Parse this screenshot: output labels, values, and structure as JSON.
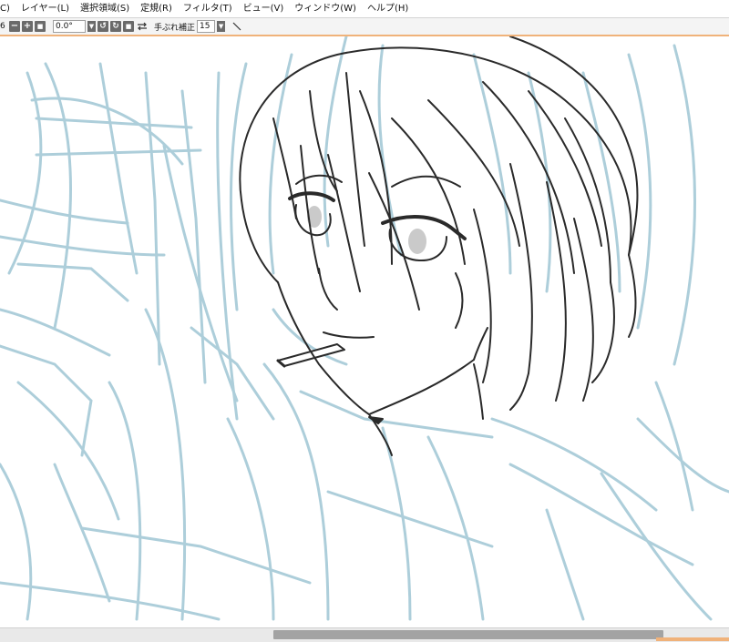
{
  "menu": [
    {
      "id": "c",
      "label": "C)"
    },
    {
      "id": "layer",
      "label": "レイヤー(L)"
    },
    {
      "id": "select",
      "label": "選択領域(S)"
    },
    {
      "id": "ruler",
      "label": "定規(R)"
    },
    {
      "id": "filter",
      "label": "フィルタ(T)"
    },
    {
      "id": "view",
      "label": "ビュー(V)"
    },
    {
      "id": "window",
      "label": "ウィンドウ(W)"
    },
    {
      "id": "help",
      "label": "ヘルプ(H)"
    }
  ],
  "toolbar": {
    "zoom_suffix": "6",
    "rotation": "0.0°",
    "stabilizer_label": "手ぶれ補正",
    "stabilizer_value": "15"
  },
  "icons": {
    "zoom_out": "minus-icon",
    "zoom_in": "plus-icon",
    "zoom_reset": "square-icon",
    "rotate_left": "rotate-left-icon",
    "rotate_right": "rotate-right-icon",
    "rotate_reset": "square-icon",
    "flip": "flip-horizontal-icon",
    "pen": "pen-icon"
  },
  "colors": {
    "accent": "#f0b27a",
    "sketch_blue": "#a9ccd9",
    "lineart": "#2a2a2a",
    "canvas_bg": "#ffffff"
  },
  "scrollbar": {
    "horizontal_position": 0.375,
    "horizontal_visible_fraction": 0.535
  }
}
